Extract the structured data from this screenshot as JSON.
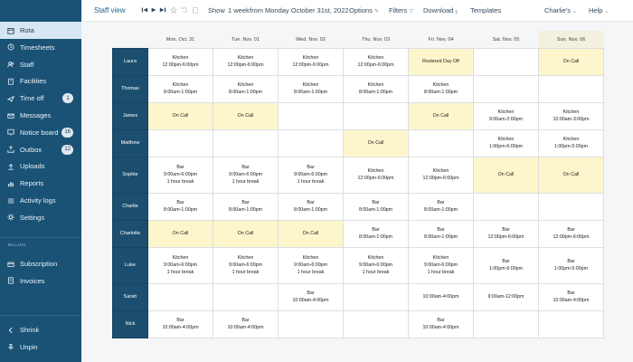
{
  "sidebar": {
    "items": [
      {
        "label": "Rota",
        "icon": "calendar-icon",
        "active": true
      },
      {
        "label": "Timesheets",
        "icon": "clock-icon"
      },
      {
        "label": "Staff",
        "icon": "users-icon"
      },
      {
        "label": "Facilities",
        "icon": "building-icon"
      },
      {
        "label": "Time off",
        "icon": "plane-icon",
        "badge": "1"
      },
      {
        "label": "Messages",
        "icon": "envelope-icon"
      },
      {
        "label": "Notice board",
        "icon": "board-icon",
        "badge": "16"
      },
      {
        "label": "Outbox",
        "icon": "outbox-icon",
        "badge": "12"
      },
      {
        "label": "Uploads",
        "icon": "upload-icon"
      },
      {
        "label": "Reports",
        "icon": "chart-icon"
      },
      {
        "label": "Activity logs",
        "icon": "list-icon"
      },
      {
        "label": "Settings",
        "icon": "gear-icon"
      }
    ],
    "billing_heading": "BILLING",
    "billing_items": [
      {
        "label": "Subscription",
        "icon": "card-icon"
      },
      {
        "label": "Invoices",
        "icon": "invoice-icon"
      }
    ],
    "footer_items": [
      {
        "label": "Shrink",
        "icon": "chevron-left-icon"
      },
      {
        "label": "Unpin",
        "icon": "unpin-icon"
      }
    ]
  },
  "toolbar": {
    "title": "Staff view",
    "show_label": "Show",
    "period": "1 week",
    "from_label": "from",
    "date": "Monday October 31st, 2022",
    "options": "Options",
    "filters": "Filters",
    "download": "Download",
    "templates": "Templates",
    "user": "Charlie's",
    "help": "Help"
  },
  "schedule": {
    "days": [
      "Mon. Oct. 31",
      "Tue. Nov. 01",
      "Wed. Nov. 02",
      "Thu. Nov. 03",
      "Fri. Nov. 04",
      "Sat. Nov. 05",
      "Sun. Nov. 06"
    ],
    "highlight_day_index": 6,
    "highlight_color": "#fdf6cc",
    "employee_color": "#1c4f6f",
    "rows": [
      {
        "name": "Laura",
        "cells": [
          {
            "lines": [
              "Kitchen",
              "12:00pm-6:00pm"
            ]
          },
          {
            "lines": [
              "Kitchen",
              "12:00pm-6:00pm"
            ]
          },
          {
            "lines": [
              "Kitchen",
              "12:00pm-6:00pm"
            ]
          },
          {
            "lines": [
              "Kitchen",
              "12:00pm-6:00pm"
            ]
          },
          {
            "lines": [
              "Rostered Day Off"
            ],
            "highlight": true
          },
          {
            "lines": []
          },
          {
            "lines": [
              "On Call"
            ],
            "highlight": true
          }
        ]
      },
      {
        "name": "Thomas",
        "cells": [
          {
            "lines": [
              "Kitchen",
              "8:00am-1:00pm"
            ]
          },
          {
            "lines": [
              "Kitchen",
              "8:00am-1:00pm"
            ]
          },
          {
            "lines": [
              "Kitchen",
              "8:00am-1:00pm"
            ]
          },
          {
            "lines": [
              "Kitchen",
              "8:00am-1:00pm"
            ]
          },
          {
            "lines": [
              "Kitchen",
              "8:00am-1:00pm"
            ]
          },
          {
            "lines": []
          },
          {
            "lines": []
          }
        ]
      },
      {
        "name": "James",
        "cells": [
          {
            "lines": [
              "On Call"
            ],
            "highlight": true
          },
          {
            "lines": [
              "On Call"
            ],
            "highlight": true
          },
          {
            "lines": []
          },
          {
            "lines": []
          },
          {
            "lines": [
              "On Call"
            ],
            "highlight": true
          },
          {
            "lines": [
              "Kitchen",
              "9:00am-2:00pm"
            ]
          },
          {
            "lines": [
              "Kitchen",
              "10:00am-3:00pm"
            ]
          }
        ]
      },
      {
        "name": "Matthew",
        "cells": [
          {
            "lines": []
          },
          {
            "lines": []
          },
          {
            "lines": []
          },
          {
            "lines": [
              "On Call"
            ],
            "highlight": true
          },
          {
            "lines": []
          },
          {
            "lines": [
              "Kitchen",
              "1:00pm-6:00pm"
            ]
          },
          {
            "lines": [
              "Kitchen",
              "1:00pm-5:00pm"
            ]
          }
        ]
      },
      {
        "name": "Sophie",
        "cells": [
          {
            "lines": [
              "Bar",
              "9:00am-6:00pm",
              "1 hour break"
            ]
          },
          {
            "lines": [
              "Bar",
              "9:00am-6:00pm",
              "1 hour break"
            ]
          },
          {
            "lines": [
              "Bar",
              "9:00am-6:00pm",
              "1 hour break"
            ]
          },
          {
            "lines": [
              "Kitchen",
              "12:00pm-6:00pm"
            ]
          },
          {
            "lines": [
              "Kitchen",
              "12:00pm-6:00pm"
            ]
          },
          {
            "lines": [
              "On Call"
            ],
            "highlight": true
          },
          {
            "lines": [
              "On Call"
            ],
            "highlight": true
          }
        ]
      },
      {
        "name": "Charlie",
        "cells": [
          {
            "lines": [
              "Bar",
              "8:00am-1:00pm"
            ]
          },
          {
            "lines": [
              "Bar",
              "8:00am-1:00pm"
            ]
          },
          {
            "lines": [
              "Bar",
              "8:00am-1:00pm"
            ]
          },
          {
            "lines": [
              "Bar",
              "8:00am-1:00pm"
            ]
          },
          {
            "lines": [
              "Bar",
              "8:00am-1:00pm"
            ]
          },
          {
            "lines": []
          },
          {
            "lines": []
          }
        ]
      },
      {
        "name": "Charlotte",
        "cells": [
          {
            "lines": [
              "On Call"
            ],
            "highlight": true
          },
          {
            "lines": [
              "On Call"
            ],
            "highlight": true
          },
          {
            "lines": [
              "On Call"
            ],
            "highlight": true
          },
          {
            "lines": [
              "Bar",
              "8:00am-1:00pm"
            ]
          },
          {
            "lines": [
              "Bar",
              "8:00am-1:00pm"
            ]
          },
          {
            "lines": [
              "Bar",
              "12:00pm-6:00pm"
            ]
          },
          {
            "lines": [
              "Bar",
              "12:00pm-6:00pm"
            ]
          }
        ]
      },
      {
        "name": "Luke",
        "cells": [
          {
            "lines": [
              "Kitchen",
              "9:00am-6:00pm",
              "1 hour break"
            ]
          },
          {
            "lines": [
              "Kitchen",
              "9:00am-6:00pm",
              "1 hour break"
            ]
          },
          {
            "lines": [
              "Kitchen",
              "9:00am-6:00pm",
              "1 hour break"
            ]
          },
          {
            "lines": [
              "Kitchen",
              "9:00am-6:00pm",
              "1 hour break"
            ]
          },
          {
            "lines": [
              "Kitchen",
              "9:00am-6:00pm",
              "1 hour break"
            ]
          },
          {
            "lines": [
              "Bar",
              "1:00pm-6:00pm"
            ]
          },
          {
            "lines": [
              "Bar",
              "1:00pm-5:00pm"
            ]
          }
        ]
      },
      {
        "name": "Sarah",
        "cells": [
          {
            "lines": []
          },
          {
            "lines": []
          },
          {
            "lines": [
              "Bar",
              "10:00am-4:00pm"
            ]
          },
          {
            "lines": []
          },
          {
            "lines": [
              "10:00am-4:00pm"
            ]
          },
          {
            "lines": [
              "9:00am-12:00pm"
            ]
          },
          {
            "lines": [
              "Bar",
              "10:00am-4:00pm"
            ]
          }
        ]
      },
      {
        "name": "Nick",
        "cells": [
          {
            "lines": [
              "Bar",
              "10:00am-4:00pm"
            ]
          },
          {
            "lines": [
              "Bar",
              "10:00am-4:00pm"
            ]
          },
          {
            "lines": []
          },
          {
            "lines": []
          },
          {
            "lines": [
              "Bar",
              "10:00am-4:00pm"
            ]
          },
          {
            "lines": []
          },
          {
            "lines": []
          }
        ]
      }
    ]
  }
}
